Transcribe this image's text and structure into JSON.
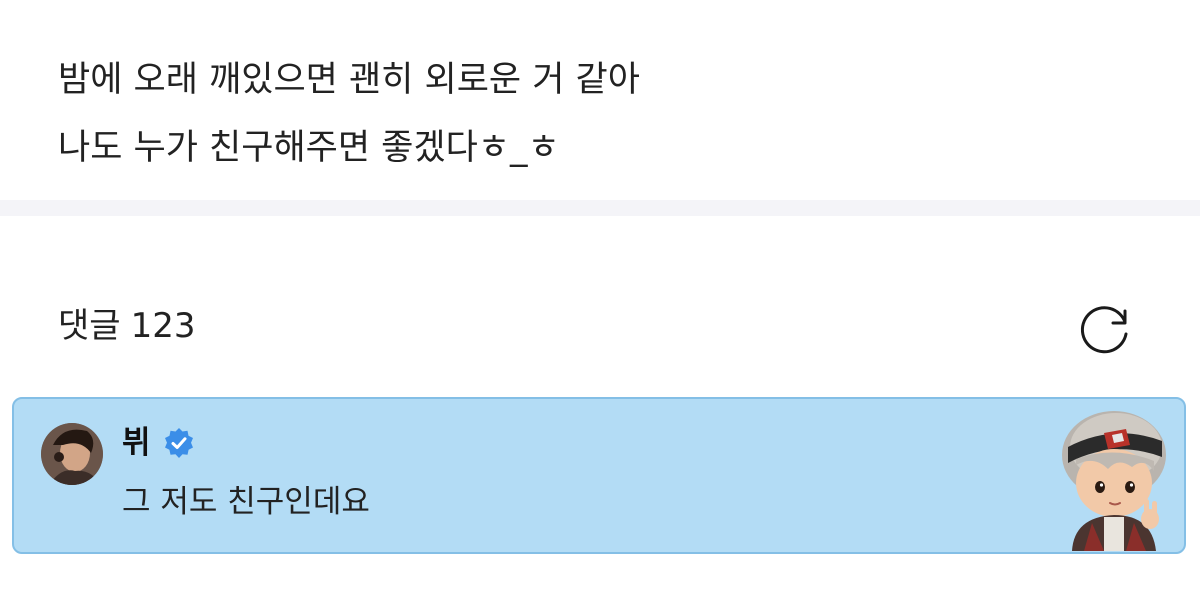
{
  "post": {
    "line1": "밤에 오래 깨있으면 괜히 외로운 거 같아",
    "line2": "나도 누가 친구해주면 좋겠다ㅎ_ㅎ"
  },
  "comments": {
    "label": "댓글",
    "count": "123",
    "refresh_icon": "refresh-icon"
  },
  "comment": {
    "author": "뷔",
    "verified_icon": "verified-badge-icon",
    "text": "그 저도 친구인데요",
    "highlight_color": "#b3dcf5",
    "border_color": "#84bfe6",
    "verified_color": "#3b8ee8"
  }
}
